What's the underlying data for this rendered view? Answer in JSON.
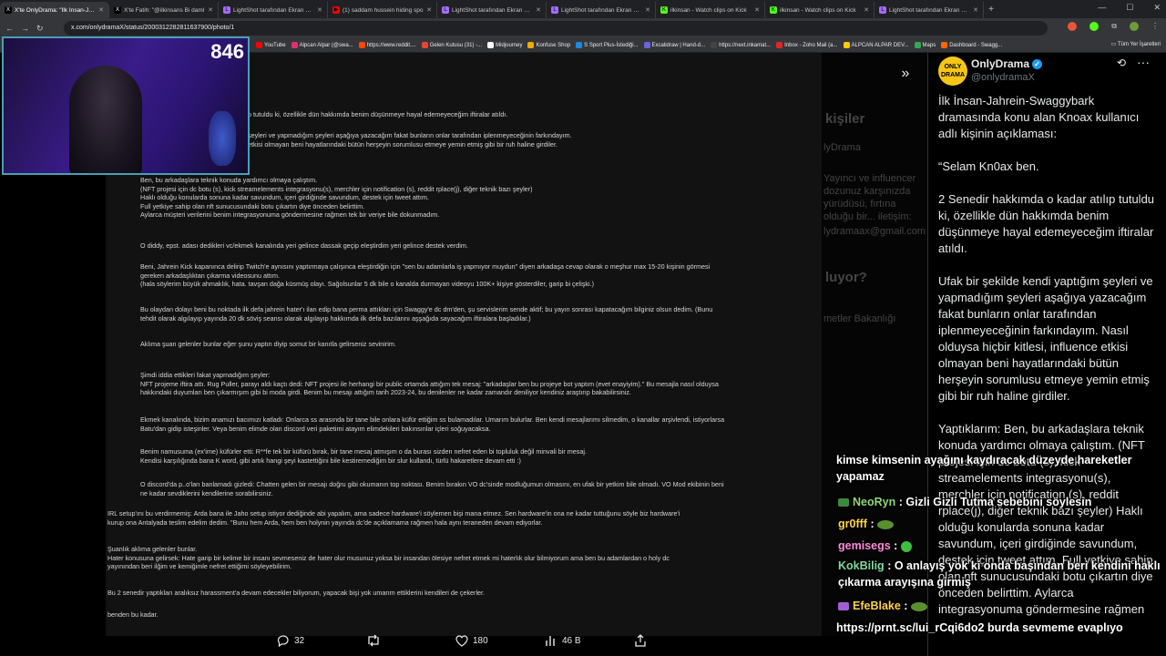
{
  "browser": {
    "tabs": [
      {
        "label": "X'te OnlyDrama: \"İlk İnsan-Jahrein",
        "favicon": "X",
        "color": "#ffffff",
        "active": true
      },
      {
        "label": "X'te Fatih: \"@ilkinsans Bi daml",
        "favicon": "X",
        "color": "#ffffff",
        "active": false
      },
      {
        "label": "LightShot tarafından Ekran Gör",
        "favicon": "L",
        "color": "#a56bff",
        "active": false
      },
      {
        "label": "(1) saddam hussein hiding spo",
        "favicon": "▶",
        "color": "#ff0000",
        "active": false
      },
      {
        "label": "LightShot tarafından Ekran Gör",
        "favicon": "L",
        "color": "#a56bff",
        "active": false
      },
      {
        "label": "LightShot tarafından Ekran Gör",
        "favicon": "L",
        "color": "#a56bff",
        "active": false
      },
      {
        "label": "ilkinsan - Watch clips on Kick",
        "favicon": "K",
        "color": "#53fc18",
        "active": false
      },
      {
        "label": "ilkinsan - Watch clips on Kick",
        "favicon": "K",
        "color": "#53fc18",
        "active": false
      },
      {
        "label": "LightShot tarafından Ekran Gör",
        "favicon": "L",
        "color": "#a56bff",
        "active": false
      }
    ],
    "new_tab": "+",
    "window_controls": [
      "—",
      "☐",
      "✕"
    ],
    "url": "x.com/onlydramaX/status/2000312282811637900/photo/1",
    "bookmarks": [
      {
        "label": "YouTube",
        "color": "#ff0000"
      },
      {
        "label": "Alpcan Alpar (@swa...",
        "color": "#e1306c"
      },
      {
        "label": "https://www.reddit....",
        "color": "#ff4500"
      },
      {
        "label": "Gelen Kutusu (31) -...",
        "color": "#ea4335"
      },
      {
        "label": "Midjourney",
        "color": "#ffffff"
      },
      {
        "label": "Konfuse Shop",
        "color": "#f2a900"
      },
      {
        "label": "S Sport Plus-İstediği...",
        "color": "#1e88e5"
      },
      {
        "label": "Excalidraw | Hand-d...",
        "color": "#6965db"
      },
      {
        "label": "https://next.inkamat...",
        "color": "#444444"
      },
      {
        "label": "Inbox - Zoho Mail (a...",
        "color": "#e42527"
      },
      {
        "label": "ALPCAN ALPAR DEV...",
        "color": "#ffcc00"
      },
      {
        "label": "Maps",
        "color": "#34a853"
      },
      {
        "label": "Dashboard - Swagg...",
        "color": "#ff6600"
      }
    ],
    "all_bookmarks": "Tüm Yer İşaretleri"
  },
  "stream": {
    "viewer_count": "846"
  },
  "document": {
    "paragraphs": [
      "p tutuldu ki, özellikle dün hakkımda benim düşünmeye hayal edemeyeceğim iftiralar atıldı.",
      "şeyleri ve yapmadığım şeyleri aşağıya yazacağım fakat bunların onlar tarafından iplenmeyeceğinin farkındayım.\n etkisi olmayan beni hayatlarındaki bütün herşeyin sorumlusu etmeye yemin etmiş gibi bir ruh haline girdiler.",
      "Ben, bu arkadaşlara teknik konuda yardımcı olmaya çalıştım.\n(NFT projesi için dc botu (s), kick streamelements integrasyonu(s), merchler için notification (s), reddit rplace(j), diğer teknik bazı şeyler)\nHaklı olduğu konularda sonuna kadar savundum, içeri girdiğinde savundum, destek için tweet attım.\nFull yetkiye sahip olan nft sunucusundaki botu çıkartın diye önceden belirttim.\nAylarca müşteri verilerini benim integrasyonuma göndermesine rağmen tek bir veriye bile dokunmadım.",
      "O diddy, epst. adası dedikleri vc/ekmek kanalında yeri gelince dassak geçip eleştirdim yeri gelince destek verdim.",
      "Beni, Jahrein Kick kapanınca delirip Twitch'e aynısını yaptırmaya çalışınca eleştirdiğin için \"sen bu adamlarla iş yapmıyor muydun\" diyen arkadaşa cevap olarak o meşhur max 15-20 kişinin görmesi\ngereken arkadaşlıktan çıkarma videosunu attım.\n(hala söylerim büyük ahmaklık, hata. tavşan dağa küsmüş olayı. Sağolsunlar 5 dk bile o kanalda durmayan videoyu 100K+ kişiye gösterdiler, garip bi çelişki.)",
      "Bu olaydan dolayı beni bu noktada ilk defa jahrein hater'ı ilan edip bana perma attıkları için Swaggy'e dc dm'den, şu servislerim sende aktif; bu yayın sonrası kapatacağım bilginiz olsun dedim. (Bunu\ntehdit olarak algılayıp yayında 20 dk söviş seansı olarak algılayıp hakkımda ilk defa bazılarını aşşağıda sayacağım iftiralara başladılar.)",
      "Aklıma şuan gelenler bunlar eğer şunu yaptın diyip somut bir kanıtla gelirseniz sevinirim.",
      "Şimdi iddia ettikleri fakat yapmadığım şeyler:\nNFT projeme iftira attı. Rug Puller, parayı aldı kaçtı dedi: NFT projesi ile herhangi bir public ortamda attığım tek mesaj: \"arkadaşlar ben bu projeye bot yaptım (evet enayiyim).\"  Bu mesajla nasıl olduysa\nhakkındaki duyumları ben çıkarmışım gibi bi moda girdi. Benim bu mesajı attığım tarih 2023-24, bu denilenler ne kadar zamandır deniliyor kendiniz araştırıp bakabilirsiniz.",
      "Ekmek kanalında, bizim anamızı bacımızı katladı: Onlarca ss arasında bir tane bile onlara küfür ettiğim ss bulamadılar. Umarım bulurlar. Ben kendi mesajlarımı silmedim, o kanallar arşivlendi, istiyorlarsa\nBatu'dan gidip isteşinler. Veya benim elimde olan discord veri paketimi atayım elimdekileri bakınsınlar içleri soğuyacaksa.",
      "Benim namusuma (ex'ime) küfürler etti: R**fe tek bir küfürü bırak, bir tane mesaj atmışım o da burası sizden nefret eden bi topluluk değil minvali bir mesaj.\nKendisi karşılığında bana K word, gibi artık hangi şeyi kastettiğini bile kestiremediğim bir slur kullandı, türlü hakaretlere devam etti :)",
      "O discord'da p..o'ları banlamadı gizledi: Chatten gelen bir mesajı doğru gibi okumanın top noktası. Benim bırakın VO dc'sinde modluğumun olmasını, en ufak bir yetkim bile olmadı. VO Mod ekibinin beni\nne kadar sevdiklerini kendilerine sorabilirsiniz.",
      "IRL setup'ını bu verdirmemiş: Arda bana ile Jaho setup istiyor dediğinde abi yapalım, ama sadece hardware'i söylemen bişi mana etmez. Sen hardware'in ona ne kadar tuttuğunu söyle biz hardware'i\nkurup ona Antalyada teslim edelim dedim. \"Bunu hem Arda, hem ben holynin yayında dc'de açıklamama rağmen hala aynı teraneden devam ediyorlar.",
      "Şuanlık aklıma gelenler bunlar.\n Hater konusuna gelirsek: Hate garip bir kelime bir insanı sevmeseniz de hater olur musunuz yoksa bir insandan ölesiye nefret etmek mi haterlık olur bilmiyorum ama ben bu adamlardan o holy dc\nyayınından beri ilğim ve kemiğimle nefret ettiğimi söyleyebilirim.",
      "Bu 2 senedir yaptıkları aralıksız harassment'a devam edecekler biliyorum, yapacak bişi yok umarım ettiklerini kendileri de çekerler.",
      "benden bu kadar."
    ]
  },
  "background_panel": {
    "texts": [
      "kişiler",
      "lyDrama",
      "Yayıncı ve influencer",
      "dozunuz karşınızda",
      "yürüdüsü, fırtına",
      "olduğu bir... iletişim:",
      "lydramaax@gmail.com",
      "luyor?",
      "metler Bakanlığı"
    ]
  },
  "viewer_actions": {
    "replies": "32",
    "reposts": "",
    "likes": "180",
    "views": "46 B"
  },
  "tweet": {
    "avatar_text": "ONLY DRAMA",
    "display_name": "OnlyDrama",
    "verified_icon": "✓",
    "handle": "@onlydramaX",
    "body": "İlk İnsan-Jahrein-Swaggybark dramasında konu alan Knoax kullanıcı adlı kişinin açıklaması:\n\n“Selam Kn0ax ben.\n\n2 Senedir hakkımda o kadar atılıp tutuldu ki, özellikle dün hakkımda benim düşünmeye hayal edemeyeceğim iftiralar atıldı.\n\nUfak bir şekilde kendi yaptığım şeyleri ve yapmadığım şeyleri aşağıya yazacağım fakat bunların onlar tarafından iplenmeyeceğinin farkındayım. Nasıl olduysa hiçbir kitlesi, influence etkisi olmayan beni hayatlarındaki bütün herşeyin sorumlusu etmeye yemin etmiş gibi bir ruh haline girdiler.\n\nYaptıklarım: Ben, bu arkadaşlara teknik konuda yardımcı olmaya çalıştım. (NFT projesi için dc botu (s), kick streamelements integrasyonu(s), merchler için notification (s), reddit rplace(j), diğer teknik bazı şeyler) Haklı olduğu konularda sonuna kadar savundum, içeri girdiğinde savundum, destek için tweet attım. Full yetkiye sahip olan nft sunucusundaki botu çıkartın diye önceden belirttim. Aylarca integrasyonuma göndermesine rağmen"
  },
  "chat": {
    "messages": [
      {
        "user": "",
        "text": "kimse kimsenin ayağını kaydıracak düzeyde hareketler yapamaz"
      },
      {
        "user": "NeoRyn",
        "text": ": Gizli Gizli Tutma sebebini söylesin"
      },
      {
        "user": "gr0fff",
        "text": ":"
      },
      {
        "user": "gemisegs",
        "text": ":"
      },
      {
        "user": "KokBilig",
        "text": ": O anlayış yok ki onda başından beri kendini haklı çıkarma arayışına girmiş"
      },
      {
        "user": "EfeBlake",
        "text": ":"
      },
      {
        "user": "",
        "text": "https://prnt.sc/lui_rCqi6do2 burda sevmeme evaplıyo"
      }
    ]
  },
  "colors": {
    "accent": "#1d9bf0",
    "chat_green": "#8ed67a",
    "chat_pink": "#ff8ad8",
    "webcam_border": "#4a9fb5"
  }
}
